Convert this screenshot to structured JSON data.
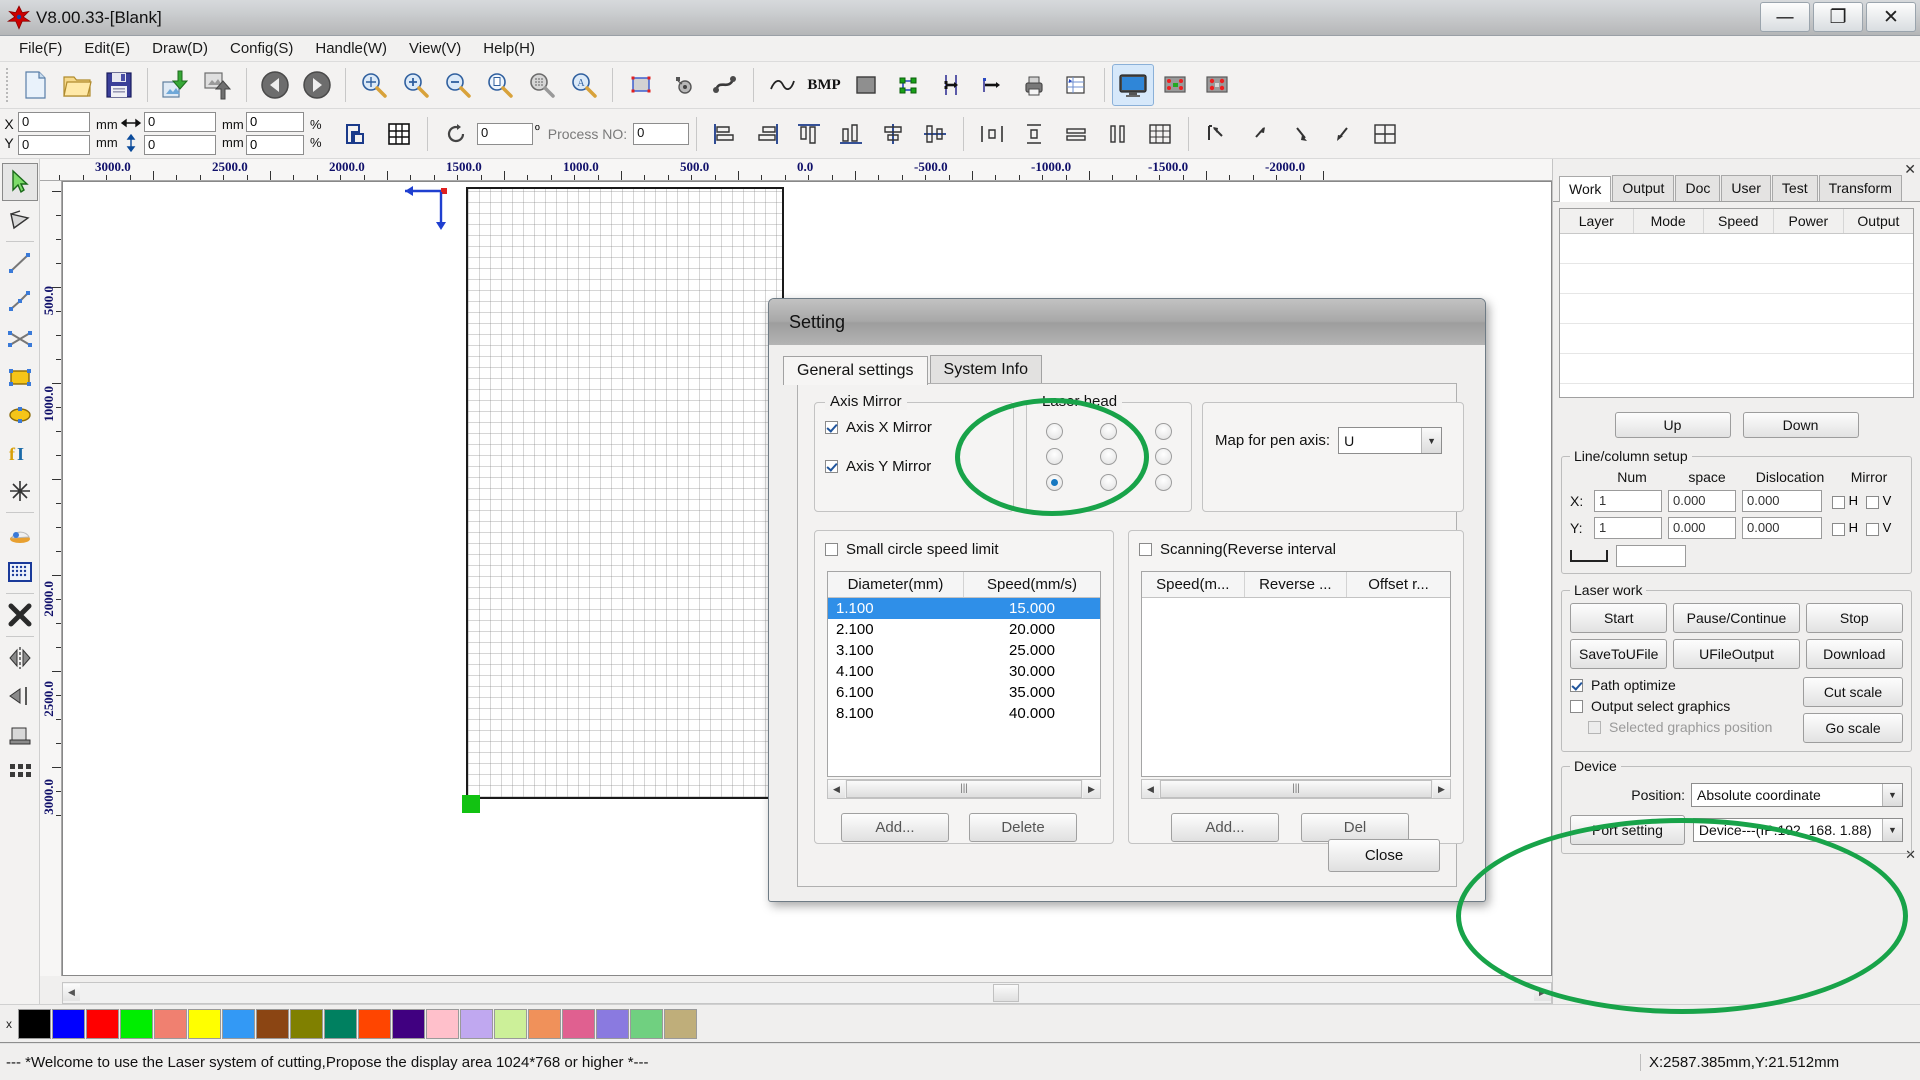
{
  "window": {
    "title": "V8.00.33-[Blank]",
    "minimize": "—",
    "maximize": "❐",
    "close": "✕"
  },
  "menu": {
    "items": [
      "File(F)",
      "Edit(E)",
      "Draw(D)",
      "Config(S)",
      "Handle(W)",
      "View(V)",
      "Help(H)"
    ]
  },
  "toolbar_main": {
    "icons": [
      "new-file-icon",
      "open-folder-icon",
      "save-icon",
      "import-icon",
      "export-icon",
      "undo-icon",
      "redo-icon",
      "zoom-pan-icon",
      "zoom-in-icon",
      "zoom-out-icon",
      "zoom-page-icon",
      "zoom-selection-icon",
      "zoom-all-icon",
      "rect-select-icon",
      "node-edit-icon",
      "path-icon",
      "curve-icon",
      "bmp-icon",
      "fill-icon",
      "group-icon",
      "mirror-h-icon",
      "mirror-v-icon",
      "print-icon",
      "array-icon",
      "monitor-icon",
      "red-dot-icon",
      "laser-dot-icon"
    ],
    "bmp_label": "BMP"
  },
  "coord_toolbar": {
    "x_label": "X",
    "y_label": "Y",
    "x_value": "0",
    "y_value": "0",
    "w_value": "0",
    "h_value": "0",
    "unit": "mm",
    "scale_x": "0",
    "scale_y": "0",
    "percent": "%",
    "angle_value": "0",
    "angle_unit": "º",
    "process_label": "Process NO:",
    "process_value": "0"
  },
  "left_tools": {
    "items": [
      "select-arrow-icon",
      "node-edit-icon",
      "line-icon",
      "polyline-icon",
      "bezier-icon",
      "rectangle-icon",
      "ellipse-icon",
      "text-icon",
      "star-icon",
      "capture-icon",
      "dot-array-icon",
      "close-x-icon",
      "mirror-icon",
      "align-icon",
      "table-icon",
      "grid-icon"
    ]
  },
  "rulers": {
    "h_labels": [
      "3000.0",
      "2500.0",
      "2000.0",
      "1500.0",
      "1000.0",
      "500.0",
      "0.0",
      "-500.0",
      "-1000.0",
      "-1500.0",
      "-2000.0"
    ],
    "v_labels": [
      "500.0",
      "1000.0",
      "2000.0",
      "2500.0",
      "3000.0"
    ]
  },
  "right_panel": {
    "close": "✕",
    "tabs": [
      "Work",
      "Output",
      "Doc",
      "User",
      "Test",
      "Transform"
    ],
    "active_tab": "Work",
    "layer_columns": [
      "Layer",
      "Mode",
      "Speed",
      "Power",
      "Output"
    ],
    "up_button": "Up",
    "down_button": "Down",
    "line_column_setup": {
      "title": "Line/column setup",
      "headers": [
        "Num",
        "space",
        "Dislocation",
        "Mirror"
      ],
      "rows": [
        {
          "axis": "X:",
          "num": "1",
          "space": "0.000",
          "dislocation": "0.000",
          "h": "H",
          "v": "V"
        },
        {
          "axis": "Y:",
          "num": "1",
          "space": "0.000",
          "dislocation": "0.000",
          "h": "H",
          "v": "V"
        }
      ]
    },
    "laser_work": {
      "title": "Laser work",
      "buttons": [
        "Start",
        "Pause/Continue",
        "Stop",
        "SaveToUFile",
        "UFileOutput",
        "Download"
      ],
      "path_optimize": "Path optimize",
      "output_select_graphics": "Output select graphics",
      "selected_graphics_position": "Selected graphics position",
      "cut_scale": "Cut scale",
      "go_scale": "Go scale"
    },
    "device": {
      "title": "Device",
      "position_label": "Position:",
      "position_value": "Absolute coordinate",
      "port_setting": "Port setting",
      "device_value": "Device---(IP:192. 168. 1.88)"
    }
  },
  "dialog": {
    "title": "Setting",
    "tabs": [
      "General settings",
      "System Info"
    ],
    "active_tab": "General settings",
    "axis_mirror": {
      "legend": "Axis Mirror",
      "axis_x": "Axis X Mirror",
      "axis_y": "Axis Y Mirror",
      "axis_x_checked": true,
      "axis_y_checked": true
    },
    "laser_head": {
      "legend": "Laser head",
      "selected_index": 6,
      "count": 9
    },
    "map_pen_axis": {
      "label": "Map for pen axis:",
      "value": "U"
    },
    "small_circle": {
      "legend": "Small circle speed limit",
      "checked": false,
      "columns": [
        "Diameter(mm)",
        "Speed(mm/s)"
      ],
      "rows": [
        {
          "diameter": "1.100",
          "speed": "15.000",
          "selected": true
        },
        {
          "diameter": "2.100",
          "speed": "20.000",
          "selected": false
        },
        {
          "diameter": "3.100",
          "speed": "25.000",
          "selected": false
        },
        {
          "diameter": "4.100",
          "speed": "30.000",
          "selected": false
        },
        {
          "diameter": "6.100",
          "speed": "35.000",
          "selected": false
        },
        {
          "diameter": "8.100",
          "speed": "40.000",
          "selected": false
        }
      ],
      "add_button": "Add...",
      "delete_button": "Delete"
    },
    "scanning": {
      "legend": "Scanning(Reverse interval",
      "checked": false,
      "columns": [
        "Speed(m...",
        "Reverse ...",
        "Offset r..."
      ],
      "rows": [],
      "add_button": "Add...",
      "del_button": "Del"
    },
    "close_button": "Close"
  },
  "palette": {
    "close": "x",
    "colors": [
      "#000000",
      "#0000ff",
      "#ff0000",
      "#00ee00",
      "#f08070",
      "#ffff00",
      "#3399f5",
      "#8b4513",
      "#808000",
      "#008060",
      "#ff4500",
      "#400080",
      "#ffc0cb",
      "#c0a8f0",
      "#ccf099",
      "#f0915a",
      "#e06090",
      "#8a7ae0",
      "#70d080",
      "#bfae7a"
    ]
  },
  "status": {
    "message": "--- *Welcome to use the Laser system of cutting,Propose the display area 1024*768 or higher *---",
    "coords": "X:2587.385mm,Y:21.512mm"
  },
  "annotations": {
    "laser_head_ellipse": "green-ellipse-laser-head",
    "device_ellipse": "green-ellipse-device"
  }
}
